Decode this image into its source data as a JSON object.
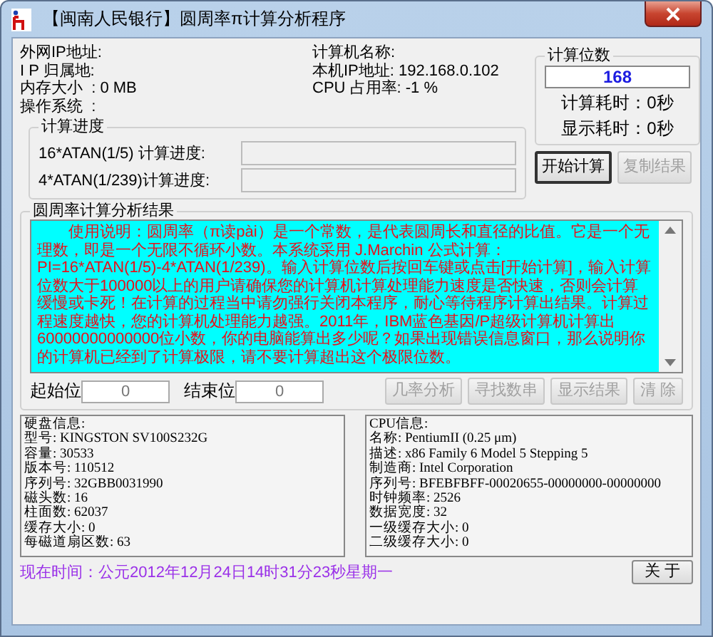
{
  "window": {
    "title": "【闽南人民银行】圆周率π计算分析程序"
  },
  "system_info": {
    "left": [
      "外网IP地址:",
      "I P 归属地:",
      "内存大小  : 0 MB",
      "操作系统  :"
    ],
    "right": [
      "计算机名称:",
      "本机IP地址: 192.168.0.102",
      "CPU 占用率: -1 %"
    ]
  },
  "progress_group": {
    "title": "计算进度",
    "rows": [
      {
        "label": "16*ATAN(1/5) 计算进度:",
        "level": 0
      },
      {
        "label": "4*ATAN(1/239)计算进度:",
        "level": 0
      }
    ]
  },
  "digits_group": {
    "title": "计算位数",
    "value": "168",
    "calc_time": "计算耗时：0秒",
    "display_time": "显示耗时：0秒"
  },
  "top_buttons": [
    {
      "label": "开始计算",
      "disabled": false
    },
    {
      "label": "复制结果",
      "disabled": true
    }
  ],
  "results_group": {
    "title": "圆周率计算分析结果",
    "text": "　　使用说明：圆周率（π读pài）是一个常数，是代表圆周长和直径的比值。它是一个无理数，即是一个无限不循环小数。本系统采用 J.Marchin 公式计算：PI=16*ATAN(1/5)-4*ATAN(1/239)。输入计算位数后按回车键或点击[开始计算]，输入计算位数大于100000以上的用户请确保您的计算机计算处理能力速度是否快速，否则会计算缓慢或卡死！在计算的过程当中请勿强行关闭本程序，耐心等待程序计算出结果。计算过程速度越快，您的计算机处理能力越强。2011年，IBM蓝色基因/P超级计算机计算出60000000000000位小数，你的电脑能算出多少呢？如果出现错误信息窗口，那么说明你的计算机已经到了计算极限，请不要计算超出这个极限位数。",
    "start_label": "起始位",
    "start_value": "0",
    "end_label": "结束位",
    "end_value": "0",
    "buttons": [
      {
        "label": "几率分析",
        "disabled": true
      },
      {
        "label": "寻找数串",
        "disabled": true
      },
      {
        "label": "显示结果",
        "disabled": true
      },
      {
        "label": "清 除",
        "disabled": true
      }
    ]
  },
  "disk_info": [
    "硬盘信息:",
    "型号: KINGSTON SV100S232G",
    "容量: 30533",
    "版本号: 110512",
    "序列号: 32GBB0031990",
    "磁头数: 16",
    "柱面数: 62037",
    "缓存大小: 0",
    "每磁道扇区数: 63"
  ],
  "cpu_info": [
    "CPU信息:",
    "名称: PentiumII (0.25 μm)",
    "描述: x86 Family 6 Model 5 Stepping 5",
    "制造商: Intel Corporation",
    "序列号: BFEBFBFF-00020655-00000000-00000000",
    "时钟频率: 2526",
    "数据宽度: 32",
    "一级缓存大小: 0",
    "二级缓存大小: 0"
  ],
  "current_time": "现在时间：公元2012年12月24日14时31分23秒星期一",
  "about_button": {
    "label": "关 于",
    "disabled": false
  }
}
